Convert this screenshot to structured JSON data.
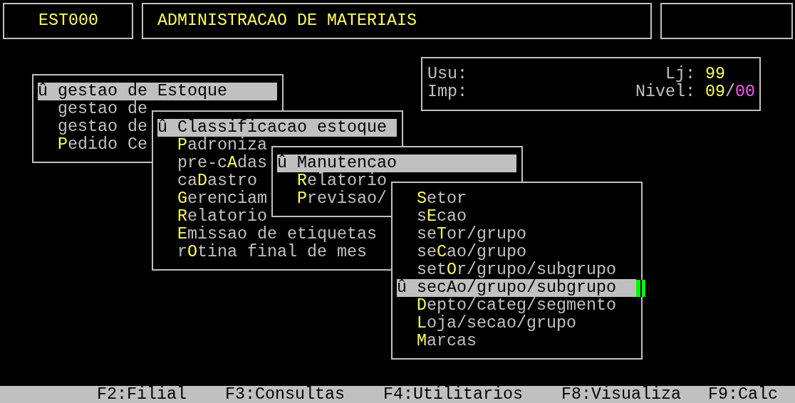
{
  "header": {
    "program_code": "EST000",
    "title": "ADMINISTRACAO DE MATERIAIS"
  },
  "info": {
    "rows": [
      {
        "label": "Usu:",
        "right_label": "Lj:",
        "right_values": [
          {
            "text": "99",
            "color": "#ffff55"
          }
        ]
      },
      {
        "label": "Imp:",
        "right_label": "Nivel:",
        "right_values": [
          {
            "text": "09",
            "color": "#ffff55"
          },
          {
            "text": "/",
            "color": "#c0c0c0"
          },
          {
            "text": "00",
            "color": "#ff55ff"
          }
        ]
      }
    ]
  },
  "menus": [
    {
      "items": [
        {
          "selected": true,
          "marker": "û",
          "text": "gestao de Estoque"
        },
        {
          "selected": false,
          "text": "gestao de"
        },
        {
          "selected": false,
          "text": "gestao de"
        },
        {
          "selected": false,
          "hotkey": "P",
          "rest": "edido Ce"
        }
      ]
    },
    {
      "items": [
        {
          "selected": true,
          "marker": "û",
          "text": "Classificacao estoque"
        },
        {
          "selected": false,
          "hotkey": "P",
          "rest": "adroniza"
        },
        {
          "selected": false,
          "prefix": "pre-c",
          "hotkey": "A",
          "rest": "das"
        },
        {
          "selected": false,
          "prefix": "ca",
          "hotkey": "D",
          "rest": "astro"
        },
        {
          "selected": false,
          "hotkey": "G",
          "rest": "erenciam"
        },
        {
          "selected": false,
          "hotkey": "R",
          "rest": "elatorio"
        },
        {
          "selected": false,
          "hotkey": "E",
          "rest": "missao de etiquetas"
        },
        {
          "selected": false,
          "prefix": "r",
          "hotkey": "O",
          "rest": "tina final de mes"
        }
      ]
    },
    {
      "items": [
        {
          "selected": true,
          "marker": "û",
          "text": "Manutencao"
        },
        {
          "selected": false,
          "hotkey": "R",
          "rest": "elatorio"
        },
        {
          "selected": false,
          "hotkey": "P",
          "rest": "revisao/"
        }
      ]
    },
    {
      "items": [
        {
          "selected": false,
          "hotkey": "S",
          "rest": "etor"
        },
        {
          "selected": false,
          "prefix": "s",
          "hotkey": "E",
          "rest": "cao"
        },
        {
          "selected": false,
          "prefix": "se",
          "hotkey": "T",
          "rest": "or/grupo"
        },
        {
          "selected": false,
          "prefix": "se",
          "hotkey": "C",
          "rest": "ao/grupo"
        },
        {
          "selected": false,
          "prefix": "set",
          "hotkey": "O",
          "rest": "r/grupo/subgrupo"
        },
        {
          "selected": true,
          "marker": "û",
          "text": "secAo/grupo/subgrupo"
        },
        {
          "selected": false,
          "hotkey": "D",
          "rest": "epto/categ/segmento"
        },
        {
          "selected": false,
          "hotkey": "L",
          "rest": "oja/secao/grupo"
        },
        {
          "selected": false,
          "hotkey": "M",
          "rest": "arcas"
        }
      ]
    }
  ],
  "function_keys": [
    "F2:Filial",
    "F3:Consultas",
    "F4:Utilitarios",
    "F8:Visualiza",
    "F9:Calc"
  ]
}
